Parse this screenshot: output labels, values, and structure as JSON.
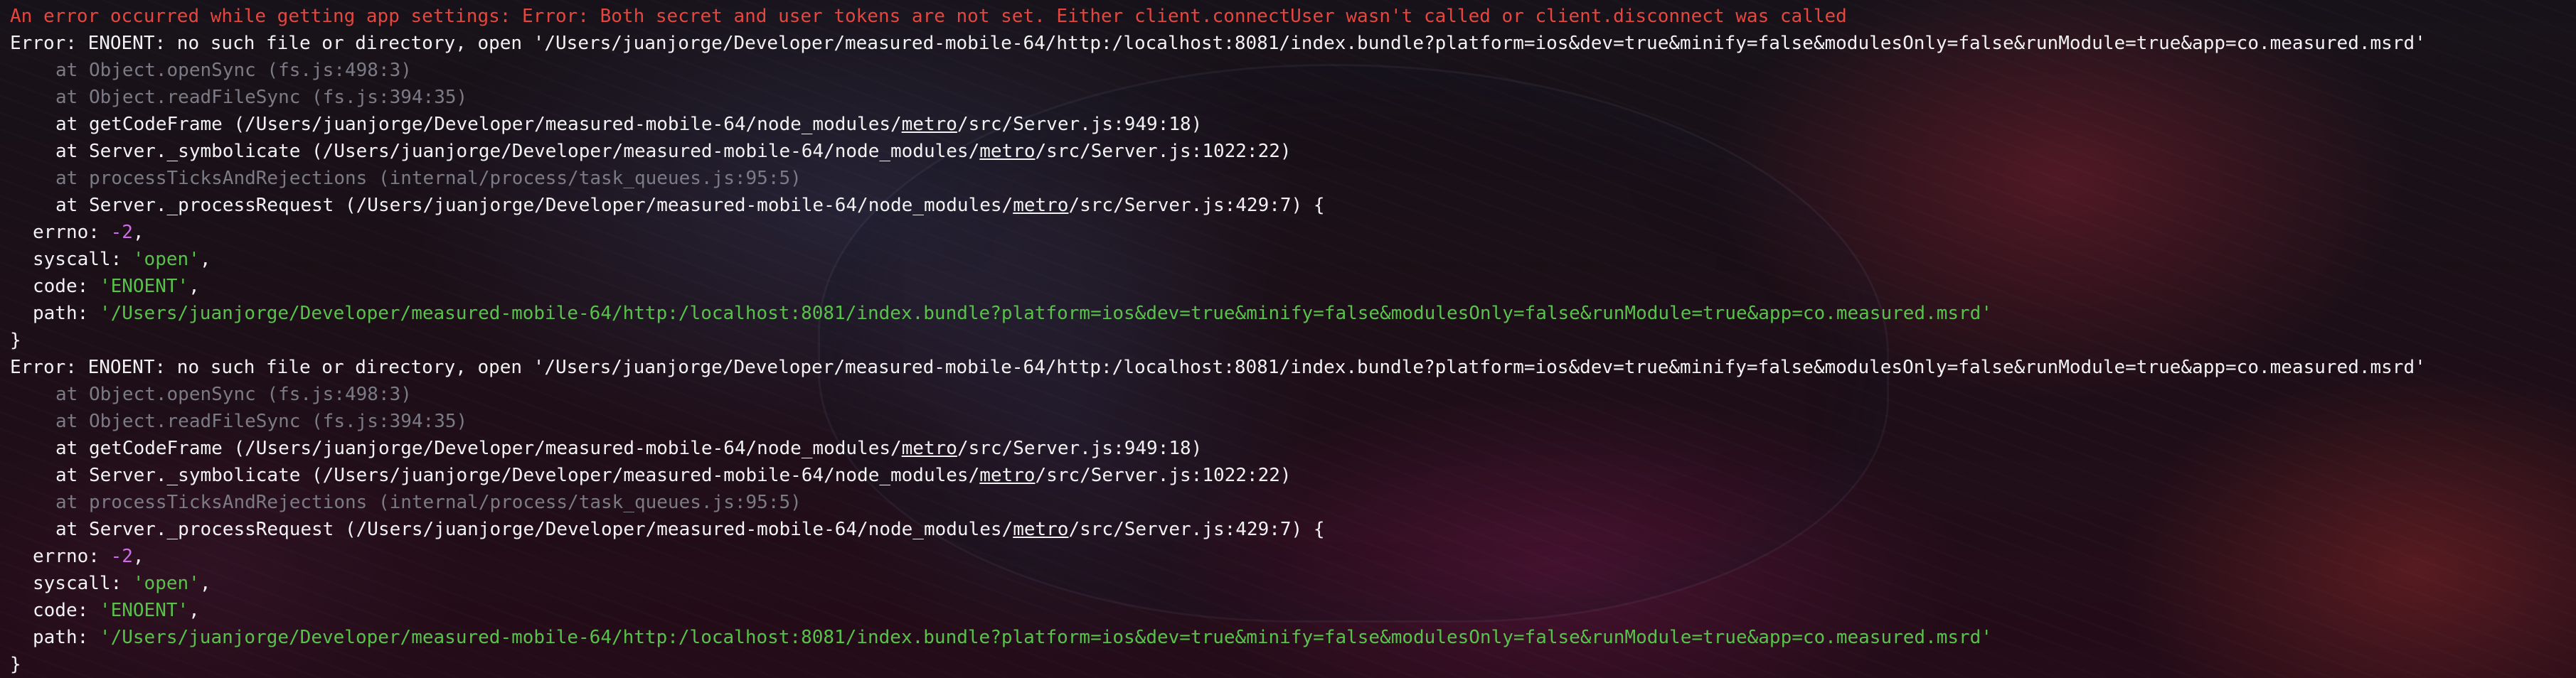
{
  "terminal": {
    "warning": "An error occurred while getting app settings: Error: Both secret and user tokens are not set. Either client.connectUser wasn't called or client.disconnect was called",
    "blocks": [
      {
        "error": "Error: ENOENT: no such file or directory, open '/Users/juanjorge/Developer/measured-mobile-64/http:/localhost:8081/index.bundle?platform=ios&dev=true&minify=false&modulesOnly=false&runModule=true&app=co.measured.msrd'",
        "stack_open_sync": "at Object.openSync (fs.js:498:3)",
        "stack_read_file_sync": "at Object.readFileSync (fs.js:394:35)",
        "stack_code_frame_pre": "at getCodeFrame (/Users/juanjorge/Developer/measured-mobile-64/node_modules/",
        "stack_code_frame_link": "metro",
        "stack_code_frame_post": "/src/Server.js:949:18)",
        "stack_symbolicate_pre": "at Server._symbolicate (/Users/juanjorge/Developer/measured-mobile-64/node_modules/",
        "stack_symbolicate_link": "metro",
        "stack_symbolicate_post": "/src/Server.js:1022:22)",
        "stack_process_ticks": "at processTicksAndRejections (internal/process/task_queues.js:95:5)",
        "stack_process_request_pre": "at Server._processRequest (/Users/juanjorge/Developer/measured-mobile-64/node_modules/",
        "stack_process_request_link": "metro",
        "stack_process_request_post": "/src/Server.js:429:7) {",
        "errno_key": "errno: ",
        "errno_value": "-2",
        "syscall_key": "syscall: ",
        "syscall_value": "'open'",
        "code_key": "code: ",
        "code_value": "'ENOENT'",
        "path_key": "path: ",
        "path_value": "'/Users/juanjorge/Developer/measured-mobile-64/http:/localhost:8081/index.bundle?platform=ios&dev=true&minify=false&modulesOnly=false&runModule=true&app=co.measured.msrd'",
        "close": "}"
      },
      {
        "error": "Error: ENOENT: no such file or directory, open '/Users/juanjorge/Developer/measured-mobile-64/http:/localhost:8081/index.bundle?platform=ios&dev=true&minify=false&modulesOnly=false&runModule=true&app=co.measured.msrd'",
        "stack_open_sync": "at Object.openSync (fs.js:498:3)",
        "stack_read_file_sync": "at Object.readFileSync (fs.js:394:35)",
        "stack_code_frame_pre": "at getCodeFrame (/Users/juanjorge/Developer/measured-mobile-64/node_modules/",
        "stack_code_frame_link": "metro",
        "stack_code_frame_post": "/src/Server.js:949:18)",
        "stack_symbolicate_pre": "at Server._symbolicate (/Users/juanjorge/Developer/measured-mobile-64/node_modules/",
        "stack_symbolicate_link": "metro",
        "stack_symbolicate_post": "/src/Server.js:1022:22)",
        "stack_process_ticks": "at processTicksAndRejections (internal/process/task_queues.js:95:5)",
        "stack_process_request_pre": "at Server._processRequest (/Users/juanjorge/Developer/measured-mobile-64/node_modules/",
        "stack_process_request_link": "metro",
        "stack_process_request_post": "/src/Server.js:429:7) {",
        "errno_key": "errno: ",
        "errno_value": "-2",
        "syscall_key": "syscall: ",
        "syscall_value": "'open'",
        "code_key": "code: ",
        "code_value": "'ENOENT'",
        "path_key": "path: ",
        "path_value": "'/Users/juanjorge/Developer/measured-mobile-64/http:/localhost:8081/index.bundle?platform=ios&dev=true&minify=false&modulesOnly=false&runModule=true&app=co.measured.msrd'",
        "close": "}"
      }
    ]
  },
  "colors": {
    "warning": "#e5463e",
    "text": "#f2f2f2",
    "dim": "#7b7b86",
    "number": "#cf6ce8",
    "string": "#58c24a"
  }
}
